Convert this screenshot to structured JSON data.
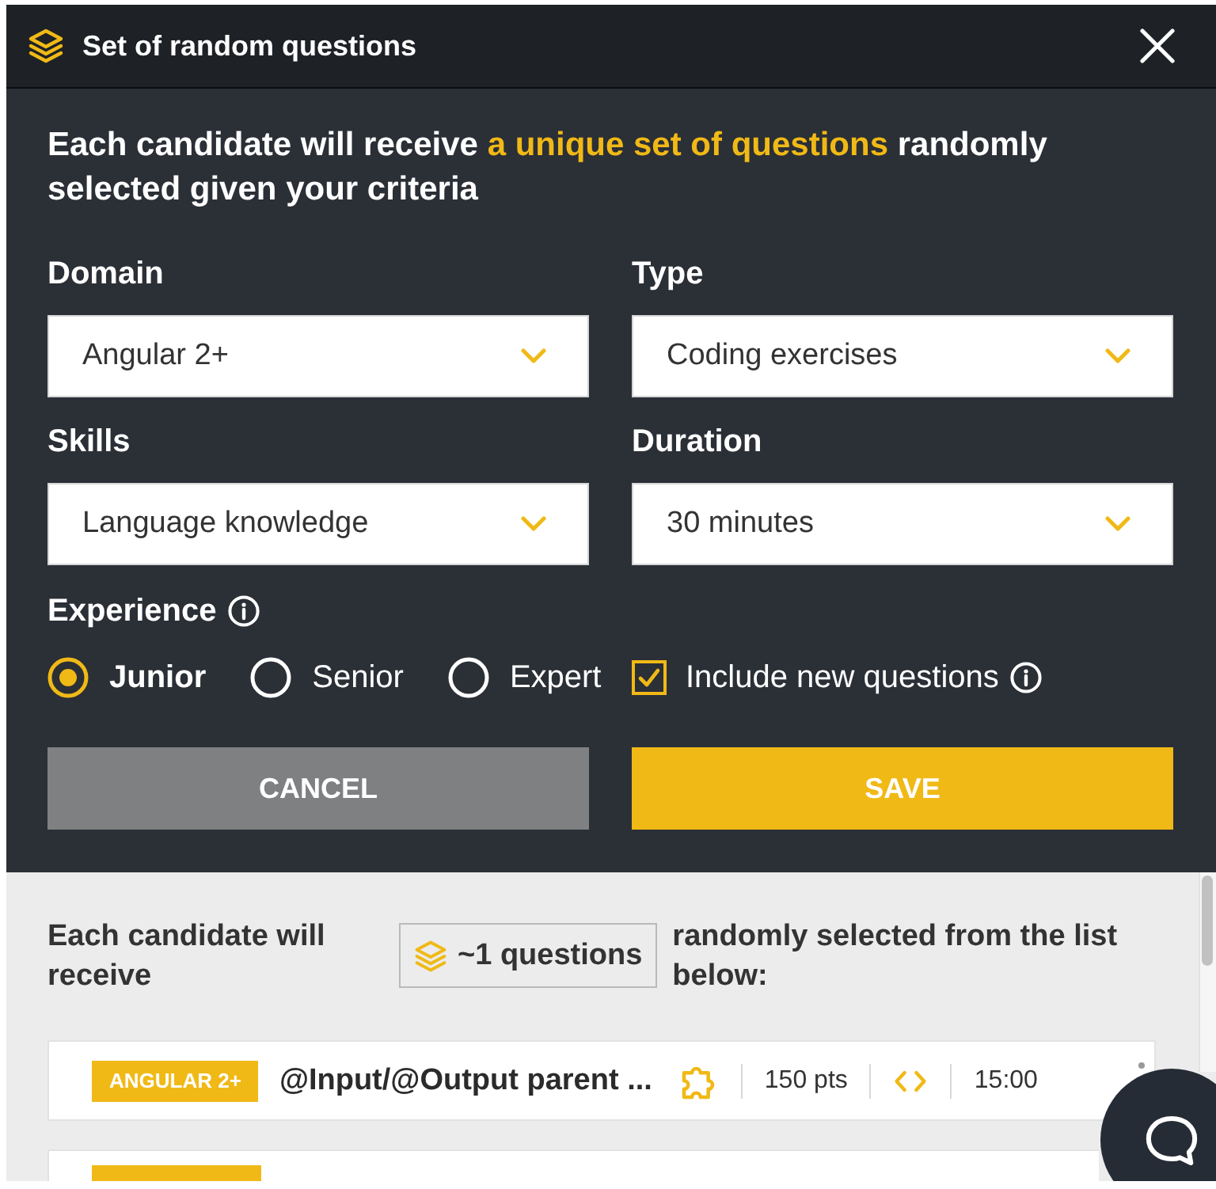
{
  "window": {
    "title": "Set of random questions"
  },
  "intro": "Each candidate will receive **a unique set of questions** randomly selected given your criteria",
  "fields": [
    {
      "label": "Domain",
      "value": "Angular 2+"
    },
    {
      "label": "Type",
      "value": "Coding exercises"
    },
    {
      "label": "Skills",
      "value": "Language knowledge"
    },
    {
      "label": "Duration",
      "value": "30 minutes"
    }
  ],
  "experience": {
    "label": "Experience",
    "options": [
      {
        "label": "Junior",
        "selected": true
      },
      {
        "label": "Senior",
        "selected": false
      },
      {
        "label": "Expert",
        "selected": false
      }
    ]
  },
  "include_new_questions": {
    "label": "Include new questions",
    "checked": true
  },
  "buttons": [
    {
      "label": "CANCEL",
      "kind": "cancel"
    },
    {
      "label": "SAVE",
      "kind": "save"
    }
  ],
  "summary": {
    "before": "Each candidate will receive",
    "count": "~1 questions",
    "after": "randomly selected from the list below:"
  },
  "questions": [
    {
      "kind": "full",
      "tag": "ANGULAR 2+",
      "title": "@Input/@Output parent ...",
      "points": "150 pts",
      "time": "15:00"
    },
    {
      "kind": "cut_off"
    }
  ]
}
